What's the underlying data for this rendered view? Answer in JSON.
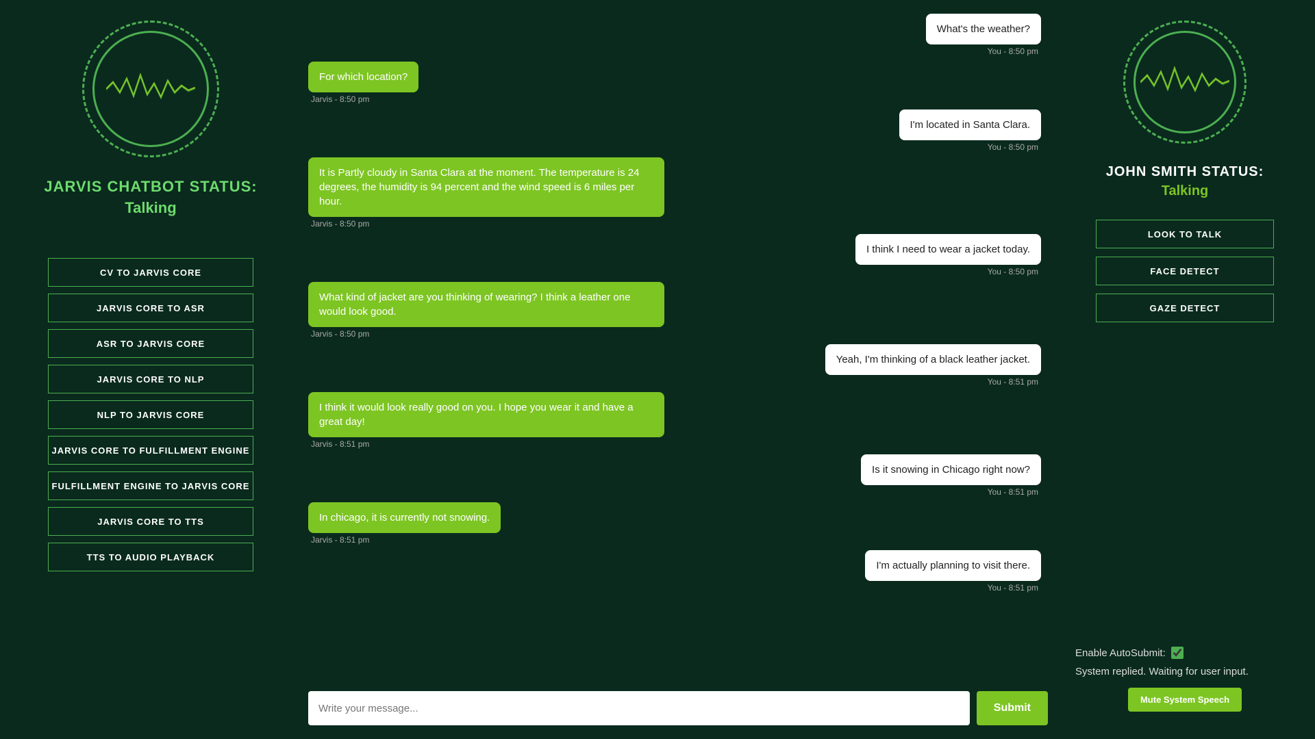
{
  "left_panel": {
    "chatbot_status_label": "JARVIS CHATBOT STATUS:",
    "chatbot_status_value": "Talking",
    "nav_buttons": [
      {
        "id": "cv-to-jarvis",
        "label": "CV TO JARVIS CORE"
      },
      {
        "id": "jarvis-to-asr",
        "label": "JARVIS CORE TO ASR"
      },
      {
        "id": "asr-to-jarvis",
        "label": "ASR TO JARVIS CORE"
      },
      {
        "id": "jarvis-to-nlp",
        "label": "JARVIS CORE TO NLP"
      },
      {
        "id": "nlp-to-jarvis",
        "label": "NLP TO JARVIS CORE"
      },
      {
        "id": "jarvis-to-fulfillment",
        "label": "JARVIS CORE TO FULFILLMENT ENGINE"
      },
      {
        "id": "fulfillment-to-jarvis",
        "label": "FULFILLMENT ENGINE TO JARVIS CORE"
      },
      {
        "id": "jarvis-to-tts",
        "label": "JARVIS CORE TO TTS"
      },
      {
        "id": "tts-to-audio",
        "label": "TTS TO AUDIO PLAYBACK"
      }
    ]
  },
  "chat": {
    "messages": [
      {
        "role": "user",
        "text": "What's the weather?",
        "meta": "You - 8:50 pm"
      },
      {
        "role": "bot",
        "text": "For which location?",
        "meta": "Jarvis - 8:50 pm"
      },
      {
        "role": "user",
        "text": "I'm located in Santa Clara.",
        "meta": "You - 8:50 pm"
      },
      {
        "role": "bot",
        "text": "It is Partly cloudy in Santa Clara at the moment. The temperature is 24 degrees, the humidity is 94 percent and the wind speed is 6 miles per hour.",
        "meta": "Jarvis - 8:50 pm"
      },
      {
        "role": "user",
        "text": "I think I need to wear a jacket today.",
        "meta": "You - 8:50 pm"
      },
      {
        "role": "bot",
        "text": "What kind of jacket are you thinking of wearing? I think a leather one would look good.",
        "meta": "Jarvis - 8:50 pm"
      },
      {
        "role": "user",
        "text": "Yeah, I'm thinking of a black leather jacket.",
        "meta": "You - 8:51 pm"
      },
      {
        "role": "bot",
        "text": "I think it would look really good on you. I hope you wear it and have a great day!",
        "meta": "Jarvis - 8:51 pm"
      },
      {
        "role": "user",
        "text": "Is it snowing in Chicago right now?",
        "meta": "You - 8:51 pm"
      },
      {
        "role": "bot",
        "text": "In chicago, it is currently not snowing.",
        "meta": "Jarvis - 8:51 pm"
      },
      {
        "role": "user",
        "text": "I'm actually planning to visit there.",
        "meta": "You - 8:51 pm"
      }
    ],
    "input_placeholder": "Write your message...",
    "submit_label": "Submit"
  },
  "right_panel": {
    "user_status_label": "JOHN SMITH STATUS:",
    "user_status_value": "Talking",
    "nav_buttons": [
      {
        "id": "look-to-talk",
        "label": "LOOK TO TALK"
      },
      {
        "id": "face-detect",
        "label": "FACE DETECT"
      },
      {
        "id": "gaze-detect",
        "label": "GAZE DETECT"
      }
    ],
    "autosubmit_label": "Enable AutoSubmit:",
    "system_status": "System replied. Waiting for user input.",
    "mute_label": "Mute System Speech"
  }
}
